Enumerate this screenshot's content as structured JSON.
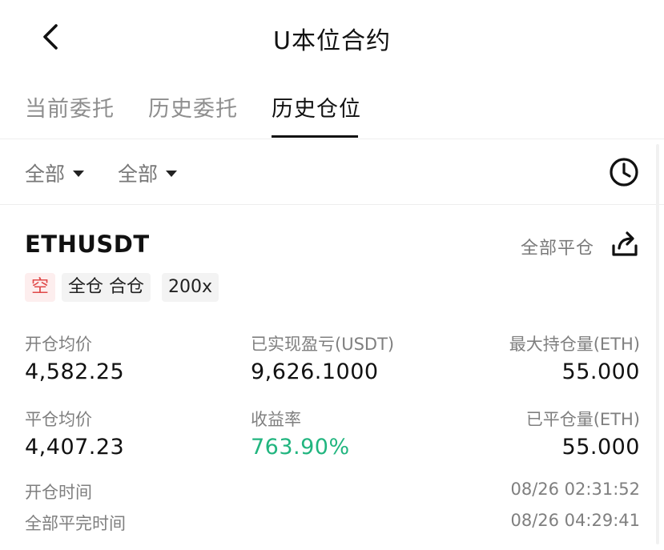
{
  "header": {
    "title": "U本位合约",
    "back_icon": "chevron-left-icon"
  },
  "tabs": [
    {
      "label": "当前委托",
      "active": false
    },
    {
      "label": "历史委托",
      "active": false
    },
    {
      "label": "历史仓位",
      "active": true
    }
  ],
  "filters": {
    "type": "全部",
    "side": "全部",
    "history_icon": "clock-icon"
  },
  "position": {
    "symbol": "ETHUSDT",
    "close_all_label": "全部平仓",
    "share_icon": "share-icon",
    "tags": {
      "direction": "空",
      "margin_mode": "全仓 合仓",
      "leverage": "200x"
    },
    "fields": {
      "open_avg_label": "开仓均价",
      "open_avg_value": "4,582.25",
      "realized_pnl_label": "已实现盈亏(USDT)",
      "realized_pnl_value": "9,626.1000",
      "max_hold_label": "最大持仓量(ETH)",
      "max_hold_value": "55.000",
      "close_avg_label": "平仓均价",
      "close_avg_value": "4,407.23",
      "roi_label": "收益率",
      "roi_value": "763.90%",
      "closed_qty_label": "已平仓量(ETH)",
      "closed_qty_value": "55.000"
    },
    "times": {
      "open_time_label": "开仓时间",
      "open_time_value": "08/26 02:31:52",
      "full_close_label": "全部平完时间",
      "full_close_value": "08/26 04:29:41"
    }
  },
  "colors": {
    "profit_green": "#21b57f",
    "short_red": "#e04848",
    "tag_red_bg": "#fdeeee",
    "tag_gray_bg": "#f3f3f3"
  }
}
